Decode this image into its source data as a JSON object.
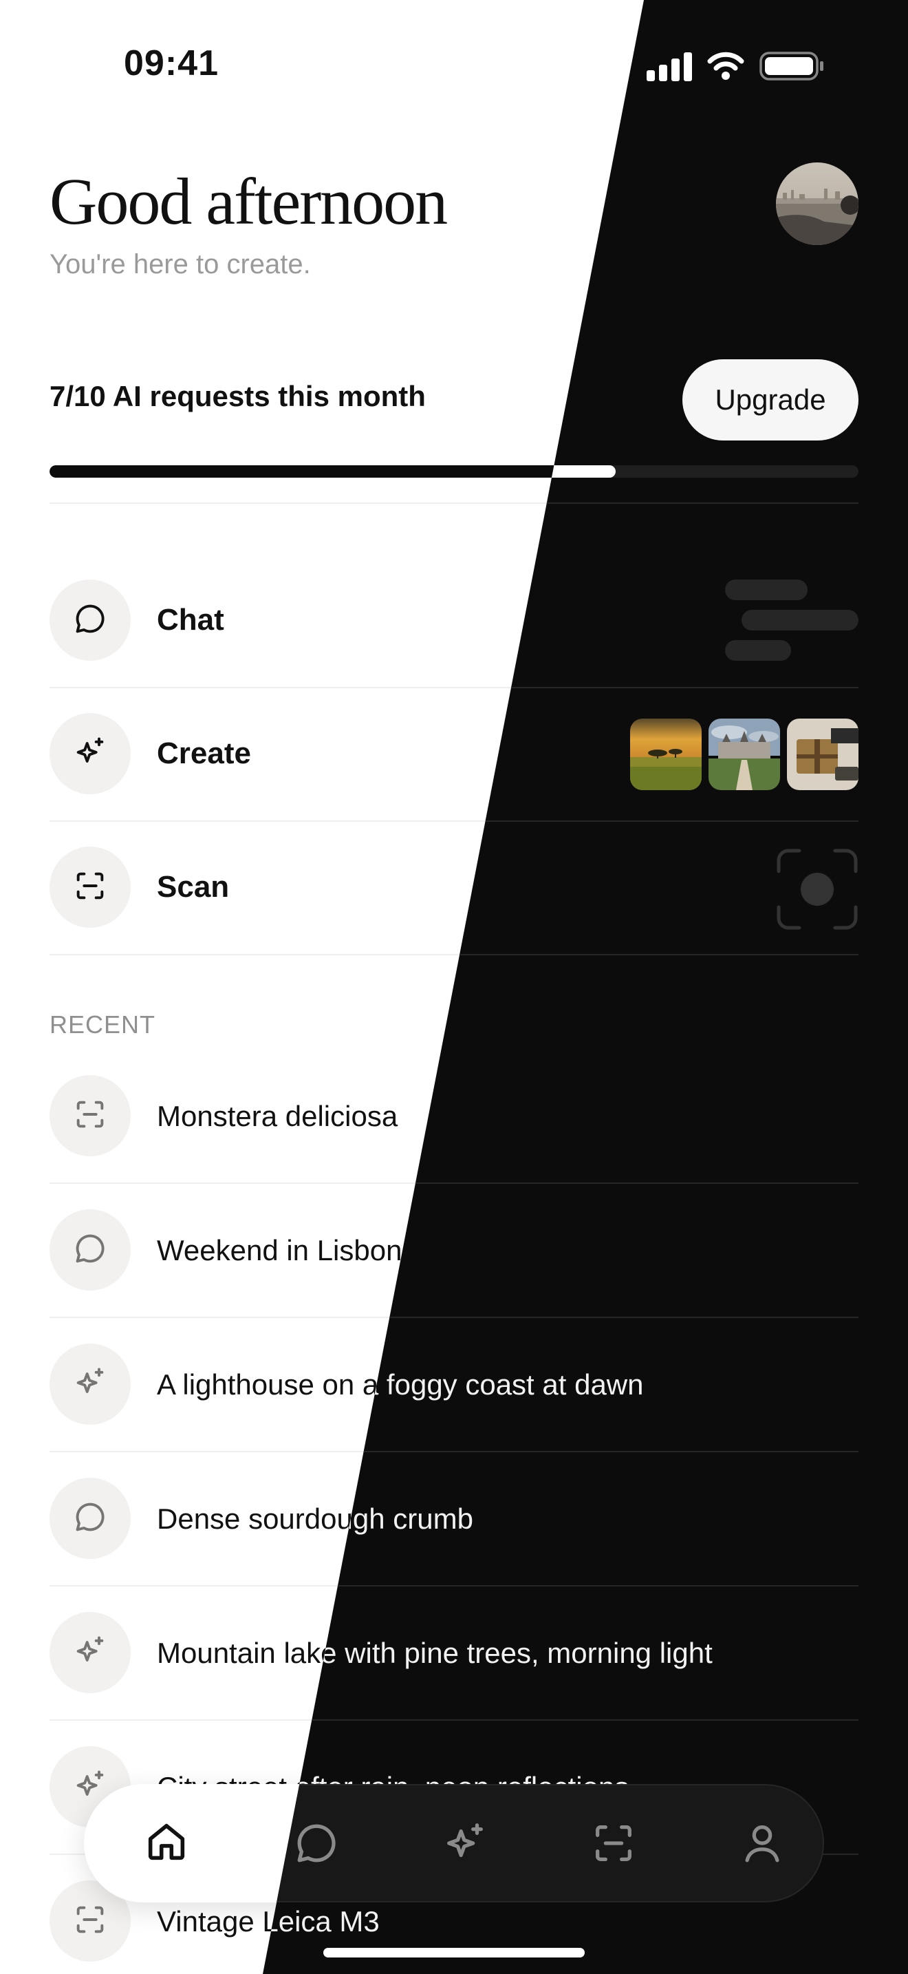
{
  "status_bar": {
    "time": "09:41"
  },
  "header": {
    "greeting": "Good afternoon",
    "subtitle": "You're here to create."
  },
  "usage": {
    "label": "7/10 AI requests this month",
    "used": 7,
    "limit": 10,
    "upgrade_label": "Upgrade"
  },
  "actions": [
    {
      "label": "Chat",
      "icon": "chat-bubble-icon"
    },
    {
      "label": "Create",
      "icon": "sparkle-icon"
    },
    {
      "label": "Scan",
      "icon": "scan-icon"
    }
  ],
  "recent": {
    "title": "RECENT",
    "items": [
      {
        "label": "Monstera deliciosa",
        "icon": "scan-icon"
      },
      {
        "label": "Weekend in Lisbon",
        "icon": "chat-bubble-icon"
      },
      {
        "label": "A lighthouse on a foggy coast at dawn",
        "icon": "sparkle-icon"
      },
      {
        "label": "Dense sourdough crumb",
        "icon": "chat-bubble-icon"
      },
      {
        "label": "Mountain lake with pine trees, morning light",
        "icon": "sparkle-icon"
      },
      {
        "label": "City street after rain, neon reflections",
        "icon": "sparkle-icon"
      },
      {
        "label": "Vintage Leica M3",
        "icon": "scan-icon"
      }
    ]
  },
  "tab_bar": {
    "tabs": [
      {
        "name": "home",
        "icon": "home-icon",
        "active": true
      },
      {
        "name": "chat",
        "icon": "chat-bubble-icon"
      },
      {
        "name": "create",
        "icon": "sparkle-icon"
      },
      {
        "name": "scan",
        "icon": "scan-icon"
      },
      {
        "name": "profile",
        "icon": "person-icon"
      }
    ]
  },
  "colors": {
    "light_bg": "#ffffff",
    "dark_bg": "#0c0c0c",
    "accent": "#111111"
  }
}
